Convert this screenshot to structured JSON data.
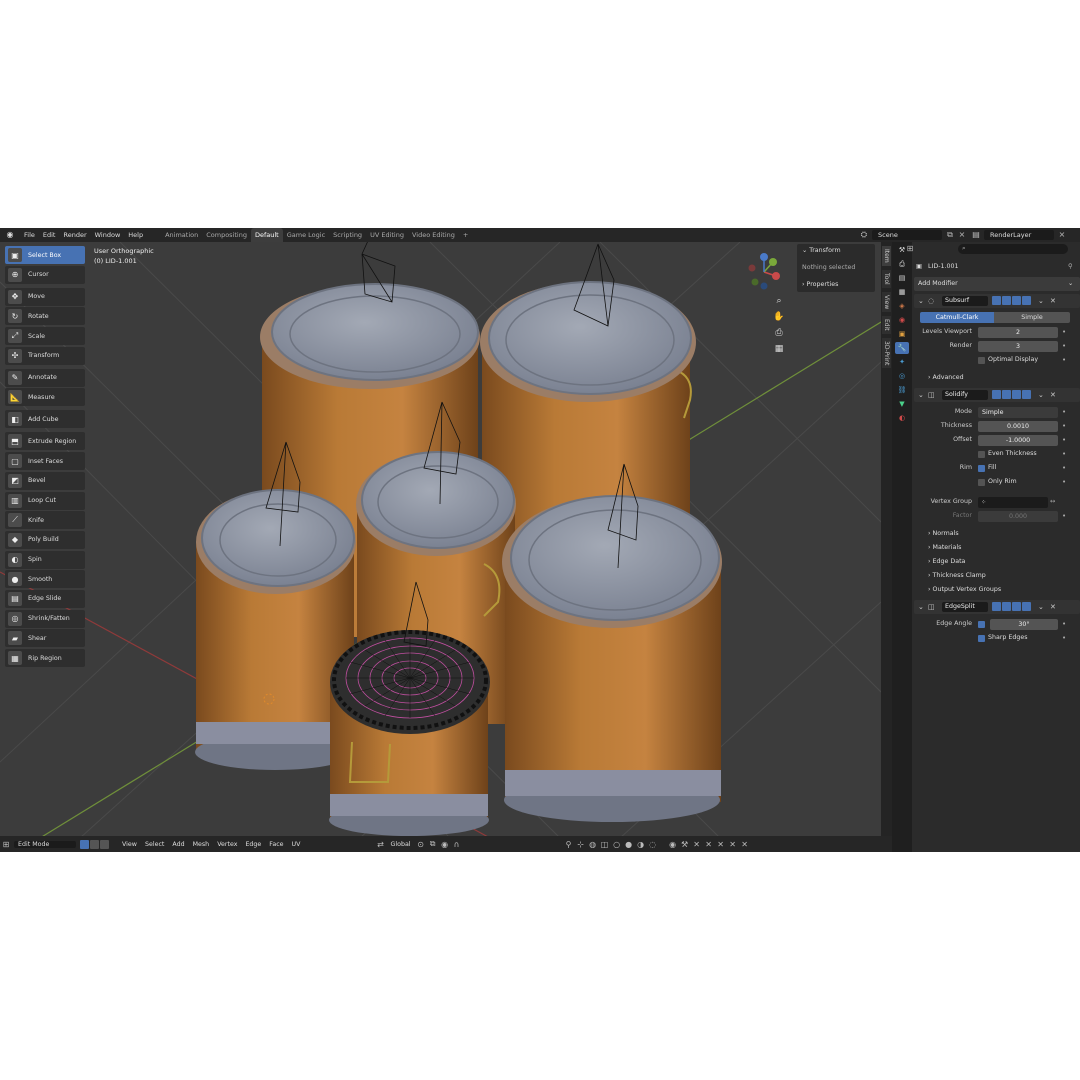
{
  "topbar": {
    "menus": [
      "File",
      "Edit",
      "Render",
      "Window",
      "Help"
    ],
    "workspaces": [
      "Animation",
      "Compositing",
      "Default",
      "Game Logic",
      "Scripting",
      "UV Editing",
      "Video Editing"
    ],
    "active_workspace": "Default",
    "add_workspace": "+",
    "scene": "Scene",
    "render_layer": "RenderLayer"
  },
  "viewport": {
    "view_name": "User Orthographic",
    "object_info": "(0) LID-1.001"
  },
  "tools": [
    {
      "label": "Select Box",
      "icon": "select-box-icon",
      "glyph": "▣",
      "active": true
    },
    {
      "label": "Cursor",
      "icon": "cursor-icon",
      "glyph": "⊕"
    },
    {
      "label": "Move",
      "icon": "move-icon",
      "glyph": "✥"
    },
    {
      "label": "Rotate",
      "icon": "rotate-icon",
      "glyph": "↻"
    },
    {
      "label": "Scale",
      "icon": "scale-icon",
      "glyph": "⤢"
    },
    {
      "label": "Transform",
      "icon": "transform-icon",
      "glyph": "✣"
    },
    {
      "label": "Annotate",
      "icon": "annotate-icon",
      "glyph": "✎"
    },
    {
      "label": "Measure",
      "icon": "measure-icon",
      "glyph": "📐"
    },
    {
      "label": "Add Cube",
      "icon": "add-cube-icon",
      "glyph": "◧"
    },
    {
      "label": "Extrude Region",
      "icon": "extrude-region-icon",
      "glyph": "⬒"
    },
    {
      "label": "Inset Faces",
      "icon": "inset-faces-icon",
      "glyph": "▢"
    },
    {
      "label": "Bevel",
      "icon": "bevel-icon",
      "glyph": "◩"
    },
    {
      "label": "Loop Cut",
      "icon": "loop-cut-icon",
      "glyph": "▥"
    },
    {
      "label": "Knife",
      "icon": "knife-icon",
      "glyph": "⟋"
    },
    {
      "label": "Poly Build",
      "icon": "poly-build-icon",
      "glyph": "◆"
    },
    {
      "label": "Spin",
      "icon": "spin-icon",
      "glyph": "◐"
    },
    {
      "label": "Smooth",
      "icon": "smooth-icon",
      "glyph": "●"
    },
    {
      "label": "Edge Slide",
      "icon": "edge-slide-icon",
      "glyph": "▤"
    },
    {
      "label": "Shrink/Fatten",
      "icon": "shrink-fatten-icon",
      "glyph": "◎"
    },
    {
      "label": "Shear",
      "icon": "shear-icon",
      "glyph": "▰"
    },
    {
      "label": "Rip Region",
      "icon": "rip-region-icon",
      "glyph": "▦"
    }
  ],
  "npanel": {
    "transform": "Transform",
    "nothing_selected": "Nothing selected",
    "properties": "Properties",
    "tabs": [
      "Item",
      "Tool",
      "View",
      "Edit",
      "3D-Print"
    ]
  },
  "statusbar": {
    "mode": "Edit Mode",
    "menus": [
      "View",
      "Select",
      "Add",
      "Mesh",
      "Vertex",
      "Edge",
      "Face",
      "UV"
    ],
    "orientation": "Global"
  },
  "properties": {
    "object_name": "LID-1.001",
    "add_modifier": "Add Modifier",
    "subsurf": {
      "name": "Subsurf",
      "catmull": "Catmull-Clark",
      "simple": "Simple",
      "levels_label": "Levels Viewport",
      "levels_value": "2",
      "render_label": "Render",
      "render_value": "3",
      "optimal": "Optimal Display",
      "advanced": "Advanced"
    },
    "solidify": {
      "name": "Solidify",
      "mode_label": "Mode",
      "mode_value": "Simple",
      "thickness_label": "Thickness",
      "thickness_value": "0.0010",
      "offset_label": "Offset",
      "offset_value": "-1.0000",
      "even": "Even Thickness",
      "rim_label": "Rim",
      "fill": "Fill",
      "only_rim": "Only Rim",
      "vgroup_label": "Vertex Group",
      "factor_label": "Factor",
      "factor_value": "0.000",
      "subs": [
        "Normals",
        "Materials",
        "Edge Data",
        "Thickness Clamp",
        "Output Vertex Groups"
      ]
    },
    "edgesplit": {
      "name": "EdgeSplit",
      "angle_label": "Edge Angle",
      "angle_value": "30°",
      "sharp": "Sharp Edges"
    }
  },
  "colors": {
    "accent": "#4772b3",
    "barrel": "#b5722f",
    "lid": "#8f96a4"
  }
}
